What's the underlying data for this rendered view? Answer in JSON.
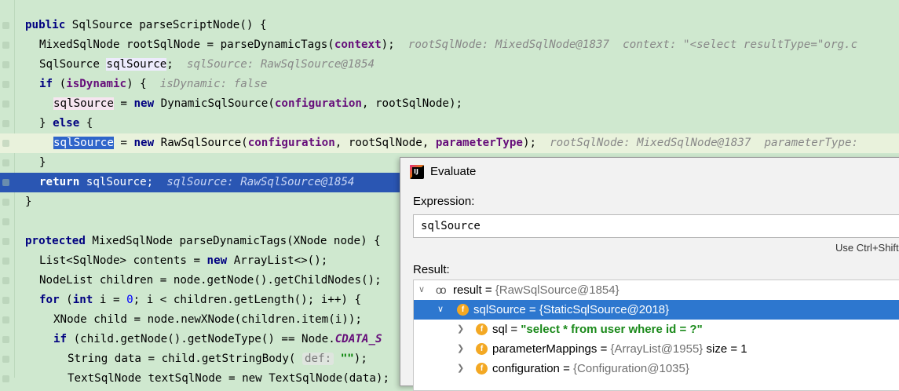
{
  "editor": {
    "lines": [
      {
        "segments": [
          {
            "t": "public",
            "c": "kw"
          },
          {
            "t": " SqlSource parseScriptNode() {",
            "c": ""
          }
        ]
      },
      {
        "segments": [
          {
            "t": "MixedSqlNode rootSqlNode = parseDynamicTags(",
            "c": ""
          },
          {
            "t": "context",
            "c": "fld"
          },
          {
            "t": ");",
            "c": ""
          },
          {
            "t": "  rootSqlNode: MixedSqlNode@1837  context: \"<select resultType=\"org.c",
            "c": "hint"
          }
        ]
      },
      {
        "segments": [
          {
            "t": "SqlSource ",
            "c": ""
          },
          {
            "t": "sqlSource",
            "c": "hl-read"
          },
          {
            "t": ";",
            "c": ""
          },
          {
            "t": "  sqlSource: RawSqlSource@1854",
            "c": "hint"
          }
        ]
      },
      {
        "segments": [
          {
            "t": "if",
            "c": "kw"
          },
          {
            "t": " (",
            "c": ""
          },
          {
            "t": "isDynamic",
            "c": "fld"
          },
          {
            "t": ") {",
            "c": ""
          },
          {
            "t": "  isDynamic: false",
            "c": "hint"
          }
        ]
      },
      {
        "segments": [
          {
            "t": "sqlSource",
            "c": "hl-write"
          },
          {
            "t": " = ",
            "c": ""
          },
          {
            "t": "new",
            "c": "kw"
          },
          {
            "t": " DynamicSqlSource(",
            "c": ""
          },
          {
            "t": "configuration",
            "c": "fld"
          },
          {
            "t": ", rootSqlNode);",
            "c": ""
          }
        ]
      },
      {
        "segments": [
          {
            "t": "} ",
            "c": ""
          },
          {
            "t": "else",
            "c": "kw"
          },
          {
            "t": " {",
            "c": ""
          }
        ]
      },
      {
        "segments": [
          {
            "t": "sqlSource",
            "c": "hl-sel"
          },
          {
            "t": " = ",
            "c": ""
          },
          {
            "t": "new",
            "c": "kw"
          },
          {
            "t": " RawSqlSource(",
            "c": ""
          },
          {
            "t": "configuration",
            "c": "fld"
          },
          {
            "t": ", rootSqlNode, ",
            "c": ""
          },
          {
            "t": "parameterType",
            "c": "fld"
          },
          {
            "t": ");",
            "c": ""
          },
          {
            "t": "  rootSqlNode: MixedSqlNode@1837  parameterType:",
            "c": "hint"
          }
        ]
      },
      {
        "segments": [
          {
            "t": "}",
            "c": ""
          }
        ]
      },
      {
        "segments": [
          {
            "t": "return",
            "c": "kw"
          },
          {
            "t": " sqlSource;",
            "c": ""
          },
          {
            "t": "  sqlSource: RawSqlSource@1854",
            "c": "hint"
          }
        ]
      },
      {
        "segments": [
          {
            "t": "}",
            "c": ""
          }
        ]
      },
      {
        "segments": [
          {
            "t": "",
            "c": ""
          }
        ]
      },
      {
        "segments": [
          {
            "t": "protected",
            "c": "kw"
          },
          {
            "t": " MixedSqlNode parseDynamicTags(XNode node) {",
            "c": ""
          }
        ]
      },
      {
        "segments": [
          {
            "t": "List<SqlNode> contents = ",
            "c": ""
          },
          {
            "t": "new",
            "c": "kw"
          },
          {
            "t": " ArrayList<>();",
            "c": ""
          }
        ]
      },
      {
        "segments": [
          {
            "t": "NodeList children = node.getNode().getChildNodes();",
            "c": ""
          }
        ]
      },
      {
        "segments": [
          {
            "t": "for",
            "c": "kw"
          },
          {
            "t": " (",
            "c": ""
          },
          {
            "t": "int",
            "c": "kw"
          },
          {
            "t": " i = ",
            "c": ""
          },
          {
            "t": "0",
            "c": "num"
          },
          {
            "t": "; i < children.getLength(); i++) {",
            "c": ""
          }
        ]
      },
      {
        "segments": [
          {
            "t": "XNode child = node.newXNode(children.item(i));",
            "c": ""
          }
        ]
      },
      {
        "segments": [
          {
            "t": "if",
            "c": "kw"
          },
          {
            "t": " (child.getNode().getNodeType() == Node.",
            "c": ""
          },
          {
            "t": "CDATA_S",
            "c": "ital"
          }
        ]
      },
      {
        "segments": [
          {
            "t": "String data = child.getStringBody( ",
            "c": ""
          },
          {
            "t": "def:",
            "c": "def"
          },
          {
            "t": " ",
            "c": ""
          },
          {
            "t": "\"\"",
            "c": "str"
          },
          {
            "t": ");",
            "c": ""
          }
        ]
      },
      {
        "segments": [
          {
            "t": "TextSqlNode textSqlNode = new TextSqlNode(data);",
            "c": ""
          }
        ]
      }
    ]
  },
  "evaluate": {
    "title": "Evaluate",
    "expression_label": "Expression:",
    "expression_value": "sqlSource",
    "shortcut_hint": "Use Ctrl+Shift",
    "result_label": "Result:",
    "tree": [
      {
        "name": "result",
        "sep": " = ",
        "value": "{RawSqlSource@1854}",
        "value_style": "gray",
        "extra": "",
        "icon": "watch-glasses-icon"
      },
      {
        "name": "sqlSource",
        "sep": " = ",
        "value": "{StaticSqlSource@2018}",
        "value_style": "gray",
        "extra": "",
        "icon": "field-icon"
      },
      {
        "name": "sql",
        "sep": " = ",
        "value": "\"select * from user where id = ?\"",
        "value_style": "green",
        "extra": "",
        "icon": "field-icon"
      },
      {
        "name": "parameterMappings",
        "sep": " = ",
        "value": "{ArrayList@1955}",
        "value_style": "gray",
        "extra": "  size = 1",
        "icon": "field-icon"
      },
      {
        "name": "configuration",
        "sep": " = ",
        "value": "{Configuration@1035}",
        "value_style": "gray",
        "extra": "",
        "icon": "field-icon"
      }
    ],
    "field_glyph": "f",
    "app_glyph": "IJ"
  }
}
